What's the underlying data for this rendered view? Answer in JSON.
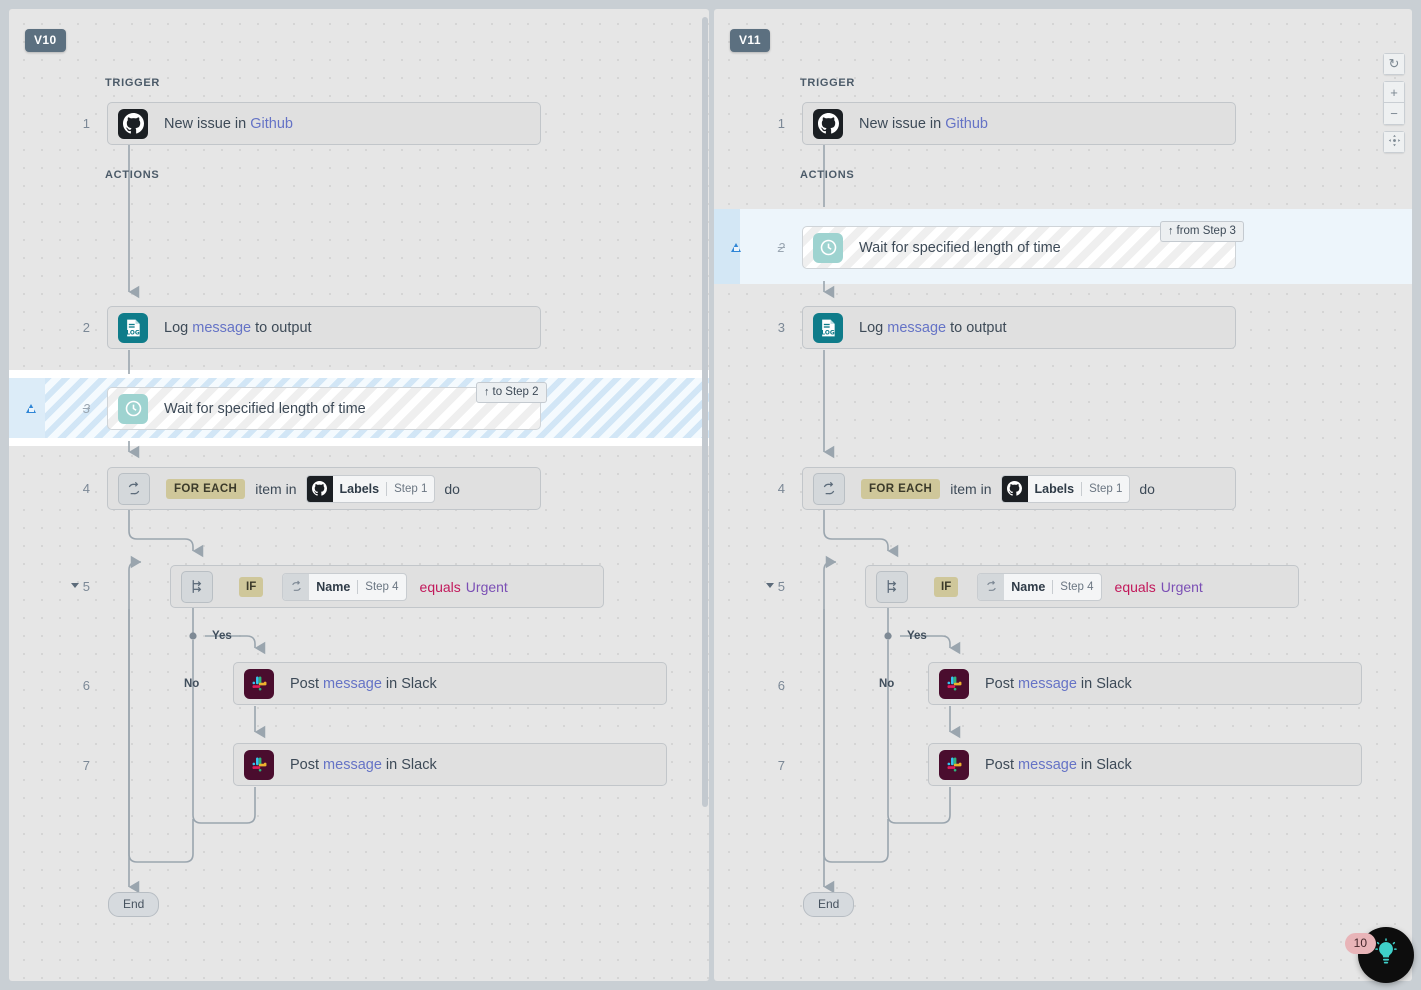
{
  "panels": [
    {
      "version_label": "V10",
      "sections": {
        "trigger": "TRIGGER",
        "actions": "ACTIONS"
      },
      "jump_badge": {
        "arrow": "↑",
        "text": "to Step 2"
      },
      "steps": [
        {
          "num": "1",
          "label_pre": "New issue in ",
          "label_accent": "Github",
          "icon": "github-icon"
        },
        {
          "num": "2",
          "label_pre": "Log ",
          "label_accent": "message",
          "label_post": " to output",
          "icon": "log-icon"
        },
        {
          "num": "3",
          "label_pre": "Wait for specified length of time",
          "icon": "clock-icon"
        },
        {
          "num": "4",
          "icon": "loop-icon",
          "keyword": "FOR EACH",
          "mid": "item in",
          "ref": {
            "name": "Labels",
            "step": "Step 1",
            "icon": "github-icon"
          },
          "tail": "do"
        },
        {
          "num": "5",
          "icon": "branch-icon",
          "keyword": "IF",
          "ref": {
            "name": "Name",
            "step": "Step 4",
            "icon": "loop-icon"
          },
          "operator": "equals",
          "value": "Urgent"
        },
        {
          "num": "6",
          "label_pre": "Post ",
          "label_accent": "message",
          "label_post": " in Slack",
          "icon": "slack-icon"
        },
        {
          "num": "7",
          "label_pre": "Post ",
          "label_accent": "message",
          "label_post": " in Slack",
          "icon": "slack-icon"
        }
      ],
      "branch_yes": "Yes",
      "branch_no": "No",
      "end_label": "End"
    },
    {
      "version_label": "V11",
      "sections": {
        "trigger": "TRIGGER",
        "actions": "ACTIONS"
      },
      "jump_badge": {
        "arrow": "↑",
        "text": "from Step 3"
      },
      "steps": [
        {
          "num": "1",
          "label_pre": "New issue in ",
          "label_accent": "Github",
          "icon": "github-icon"
        },
        {
          "num": "2",
          "label_pre": "Wait for specified length of time",
          "icon": "clock-icon"
        },
        {
          "num": "3",
          "label_pre": "Log ",
          "label_accent": "message",
          "label_post": " to output",
          "icon": "log-icon"
        },
        {
          "num": "4",
          "icon": "loop-icon",
          "keyword": "FOR EACH",
          "mid": "item in",
          "ref": {
            "name": "Labels",
            "step": "Step 1",
            "icon": "github-icon"
          },
          "tail": "do"
        },
        {
          "num": "5",
          "icon": "branch-icon",
          "keyword": "IF",
          "ref": {
            "name": "Name",
            "step": "Step 4",
            "icon": "loop-icon"
          },
          "operator": "equals",
          "value": "Urgent"
        },
        {
          "num": "6",
          "label_pre": "Post ",
          "label_accent": "message",
          "label_post": " in Slack",
          "icon": "slack-icon"
        },
        {
          "num": "7",
          "label_pre": "Post ",
          "label_accent": "message",
          "label_post": " in Slack",
          "icon": "slack-icon"
        }
      ],
      "branch_yes": "Yes",
      "branch_no": "No",
      "end_label": "End"
    }
  ],
  "zoom_tools": {
    "reset": "↻",
    "zoom_in": "+",
    "zoom_out": "−",
    "fit": "fit-icon"
  },
  "helper": {
    "badge_count": "10",
    "icon": "lightbulb-icon"
  },
  "colors": {
    "canvas": "#e6e6e6",
    "page": "#c9cfd4",
    "node": "#e0e0e0",
    "accent_link": "#6573c6",
    "operator": "#c2185b",
    "value": "#7b4fb5",
    "keyword_chip": "#cfc79a",
    "version_badge": "#5c7080",
    "highlight_left": "#f4fafe",
    "highlight_right": "#edf5fb",
    "slack": "#4a0d2e",
    "log": "#0f7c8a",
    "clock": "#9ed3d0",
    "github": "#1b1f23"
  }
}
